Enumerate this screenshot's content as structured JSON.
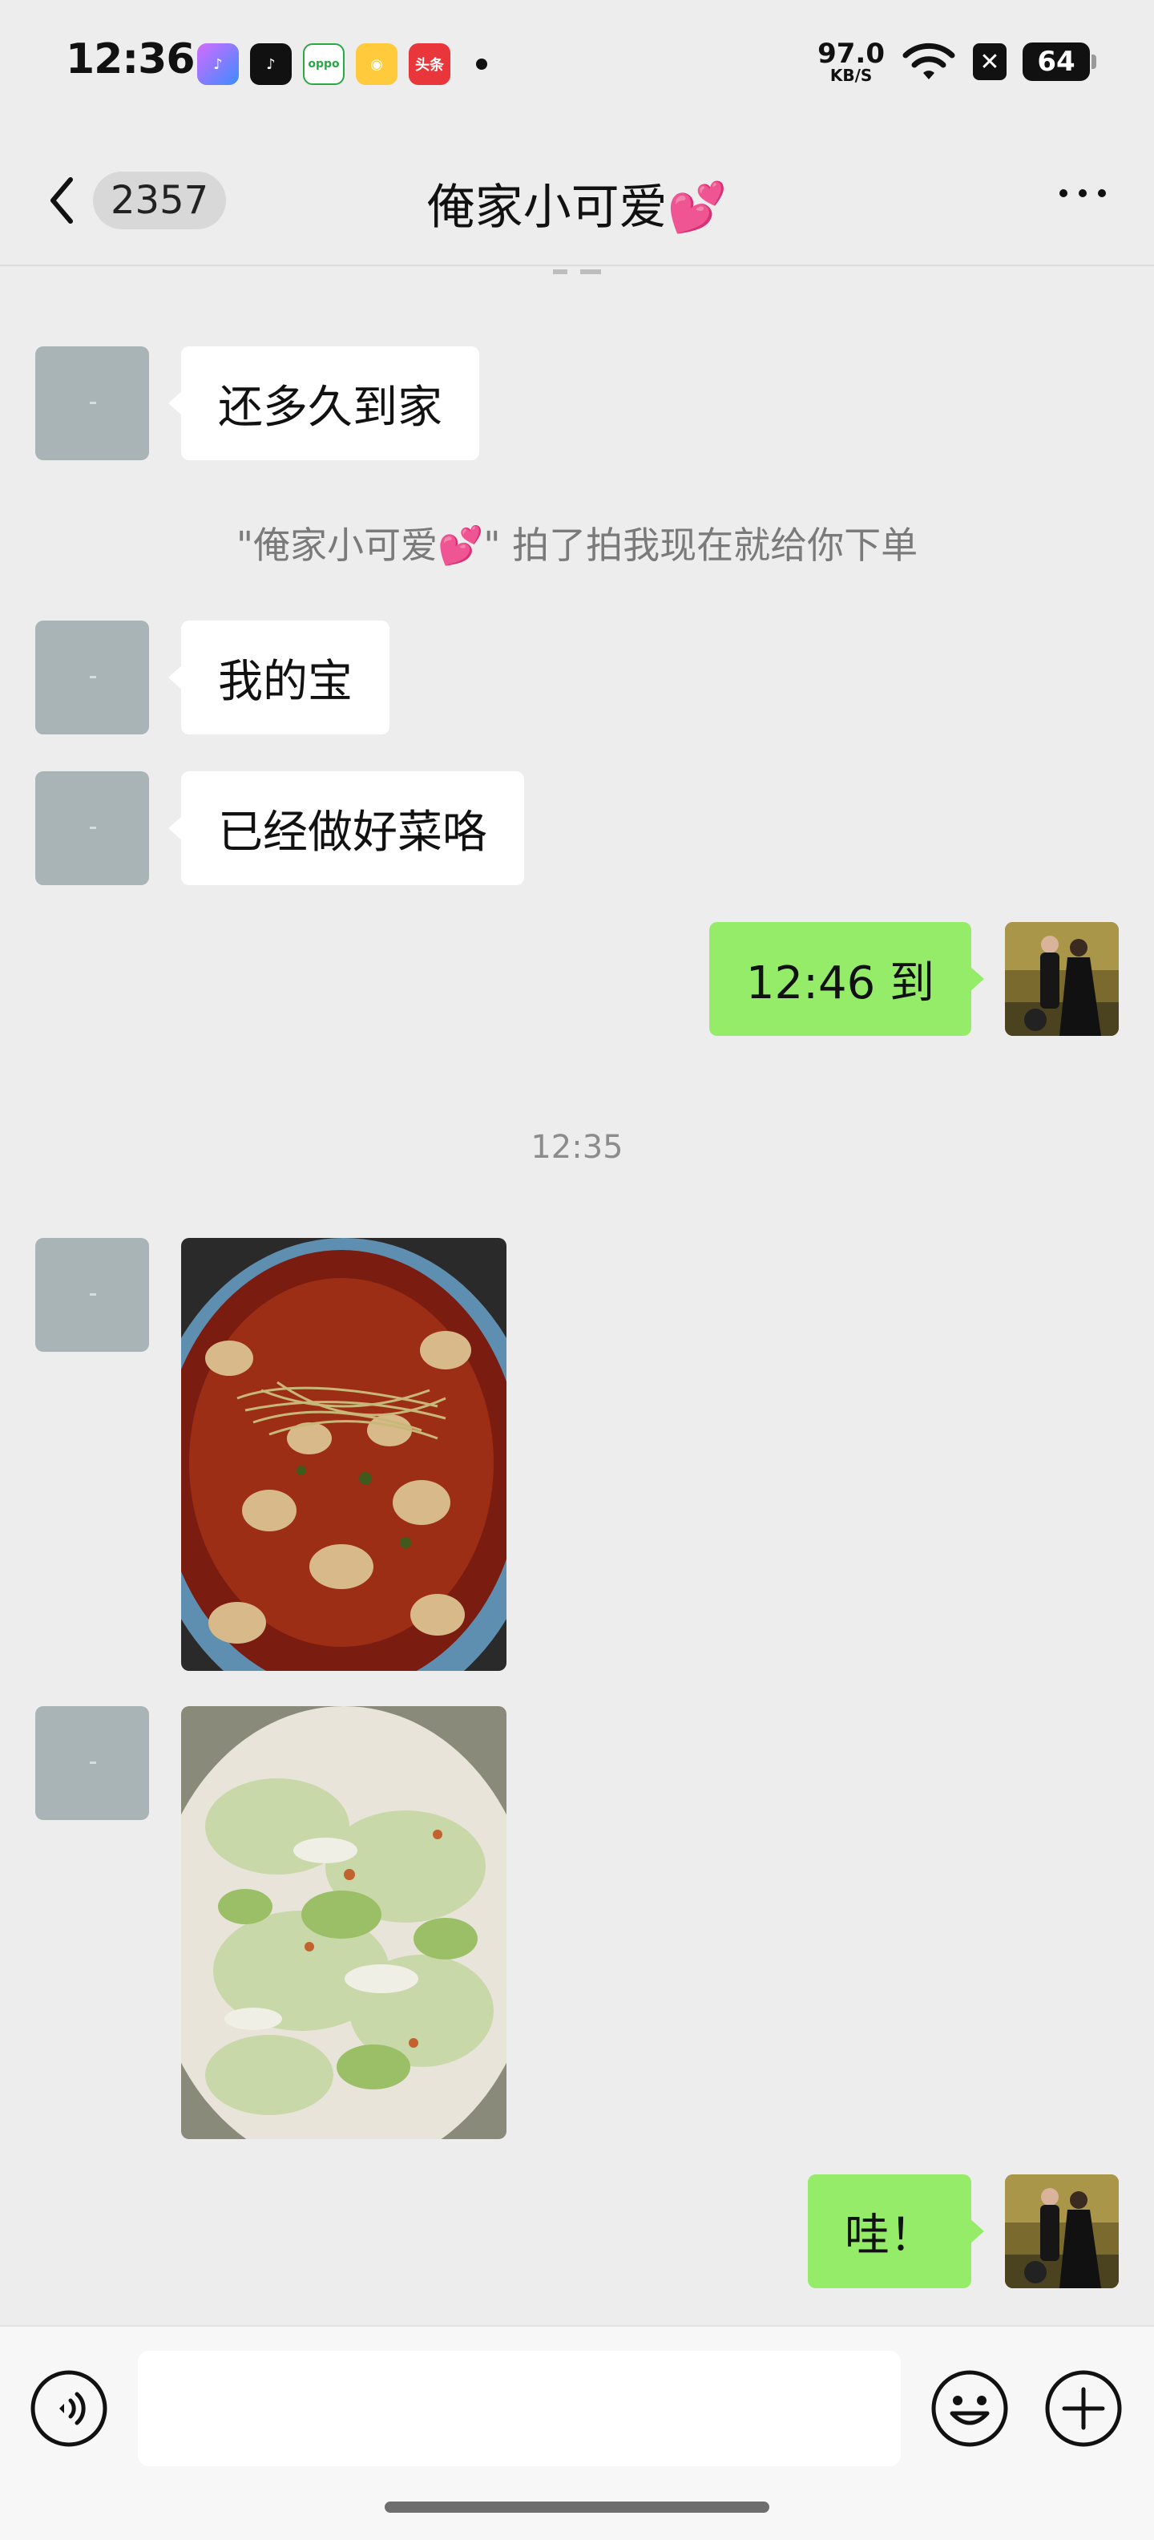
{
  "status_bar": {
    "time": "12:36",
    "apps": [
      {
        "name": "music-app-icon",
        "label": "♪"
      },
      {
        "name": "douyin-app-icon",
        "label": "♪"
      },
      {
        "name": "oppo-app-icon",
        "label": "oppo"
      },
      {
        "name": "weibo-app-icon",
        "label": "◉"
      },
      {
        "name": "toutiao-app-icon",
        "label": "头条"
      }
    ],
    "net_speed": "97.0",
    "net_unit": "KB/S",
    "battery": "64"
  },
  "header": {
    "unread_count": "2357",
    "title": "俺家小可爱💕"
  },
  "messages": {
    "m1": "还多久到家",
    "pat_note": "\"俺家小可爱💕\" 拍了拍我现在就给你下单",
    "m2": "我的宝",
    "m3": "已经做好菜咯",
    "m4": "12:46 到",
    "time_1235": "12:35",
    "m5": "哇！"
  },
  "input_bar": {
    "placeholder": ""
  },
  "colors": {
    "background": "#ededed",
    "own_bubble": "#95ec69",
    "other_bubble": "#ffffff"
  }
}
